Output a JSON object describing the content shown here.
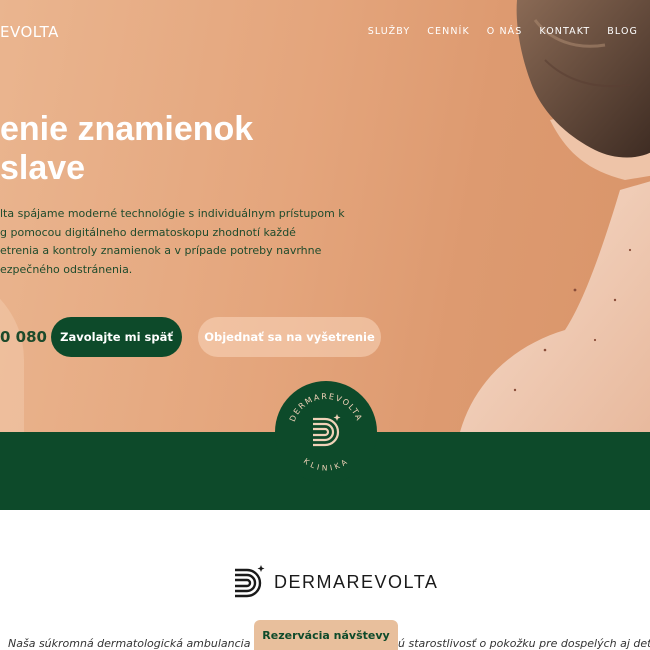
{
  "header": {
    "logo_text": "EVOLTA",
    "nav": [
      "SLUŽBY",
      "CENNÍK",
      "O NÁS",
      "KONTAKT",
      "BLOG"
    ]
  },
  "hero": {
    "title_line1": "enie znamienok",
    "title_line2": "slave",
    "lead_lines": [
      "lta spájame moderné technológie s individuálnym prístupom k",
      "g pomocou digitálneho dermatoskopu zhodnotí každé",
      "etrenia a kontroly znamienok a v prípade potreby navrhne",
      "ezpečného odstránenia."
    ],
    "phone_partial": "0 080",
    "call_button": "Zavolajte mi späť",
    "book_button": "Objednať sa na vyšetrenie"
  },
  "badge": {
    "top_text": "DERMAREVOLTA",
    "bottom_text": "KLINIKA"
  },
  "brand": {
    "name": "DERMAREVOLTA"
  },
  "intro": {
    "left": "Naša súkromná dermatologická ambulancia v B",
    "right": "ú starostlivosť o pokožku pre dospelých aj deti."
  },
  "reserve_button": "Rezervácia návštevy",
  "colors": {
    "brand_green": "#0d4a2a",
    "peach": "#e4a57c",
    "reserve_tab": "#e8bf9c"
  }
}
